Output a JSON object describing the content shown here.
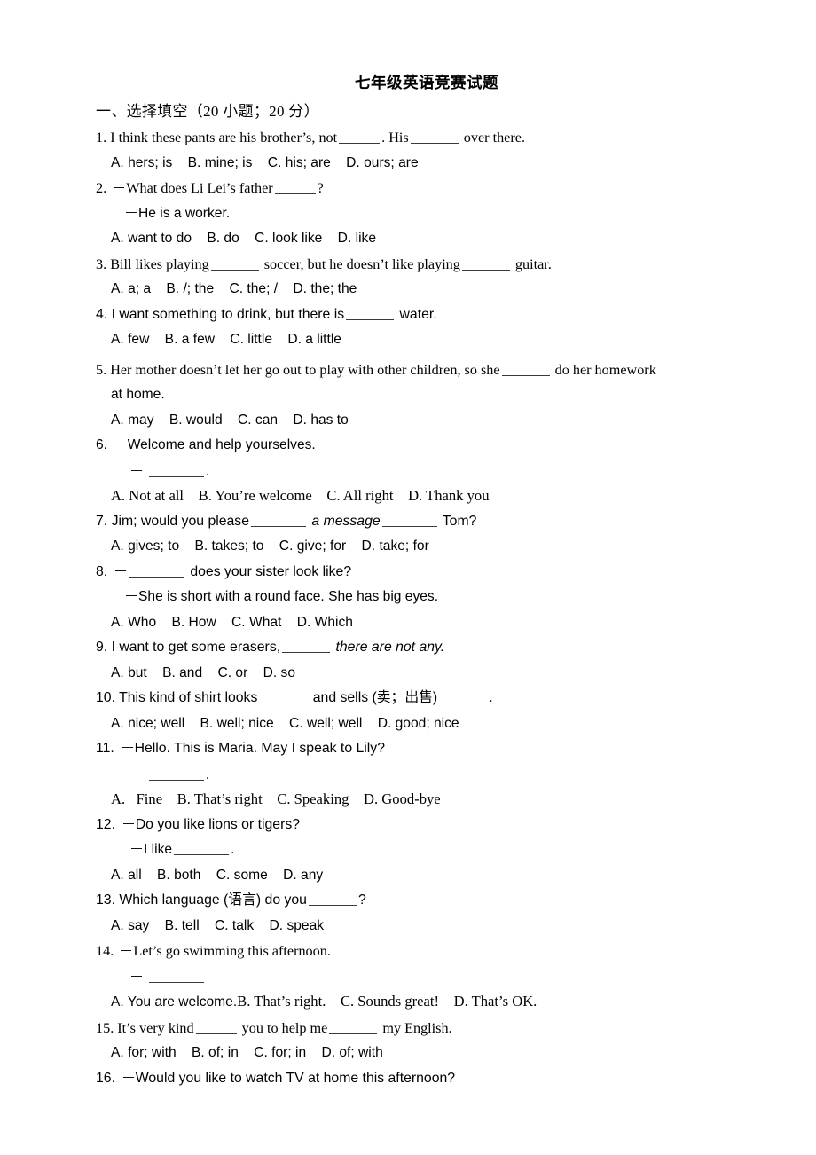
{
  "document": {
    "title": "七年级英语竞赛试题",
    "section_heading": "一、选择填空（20 小题；20 分）"
  },
  "questions": [
    {
      "number": "1.",
      "stem_pre": "I think these pants are his brother’s, not",
      "stem_mid": ". His",
      "stem_post": "over there.",
      "options": "A. hers; is    B. mine; is    C. his; are    D. ours; are"
    },
    {
      "number": "2.",
      "prompt": "What does Li Lei’s father",
      "prompt_post": "?",
      "reply": "He is a worker.",
      "options": "A. want to do    B. do    C. look like    D. like"
    },
    {
      "number": "3.",
      "stem_pre": "Bill likes playing",
      "stem_mid": "soccer, but he doesn’t like playing",
      "stem_post": "guitar.",
      "options": "A. a; a    B. /; the    C. the; /    D. the; the"
    },
    {
      "number": "4.",
      "stem_pre": "I want something to drink, but there is",
      "stem_post": "water.",
      "options": "A. few    B. a few    C. little    D. a little"
    },
    {
      "number": "5.",
      "stem_pre": "Her mother doesn’t let her go out to play with other children, so she",
      "stem_post": "do her homework",
      "stem_line2": "at home.",
      "options": "A. may    B. would    C. can    D. has to"
    },
    {
      "number": "6.",
      "prompt": "Welcome and help yourselves.",
      "reply_post": ".",
      "options": "A. Not at all    B. You’re welcome    C. All right    D. Thank you"
    },
    {
      "number": "7.",
      "stem_pre": "Jim; would you please",
      "stem_mid": "a message",
      "stem_post": "Tom?",
      "options": "A. gives; to    B. takes; to    C. give; for    D. take; for"
    },
    {
      "number": "8.",
      "stem_post": "does your sister look like?",
      "reply": "She is short with a round face. She has big eyes.",
      "options": "A. Who    B. How    C. What    D. Which"
    },
    {
      "number": "9.",
      "stem_pre": "I want to get some erasers,",
      "stem_post": "there are not any.",
      "options": "A. but    B. and    C. or    D. so"
    },
    {
      "number": "10.",
      "stem_pre": "This kind of shirt looks",
      "stem_mid": "and sells (卖；出售)",
      "stem_post": ".",
      "options": "A. nice; well    B. well; nice    C. well; well    D. good; nice"
    },
    {
      "number": "11.",
      "prompt": "Hello. This is Maria. May I speak to Lily?",
      "reply_post": ".",
      "options": "A.   Fine    B. That’s right    C. Speaking    D. Good-bye"
    },
    {
      "number": "12.",
      "prompt": "Do you like lions or tigers?",
      "reply_pre": "I like",
      "reply_post": ".",
      "options": "A. all    B. both    C. some    D. any"
    },
    {
      "number": "13.",
      "stem_pre": "Which language (语言) do you",
      "stem_post": "?",
      "options": "A. say    B. tell    C. talk    D. speak"
    },
    {
      "number": "14.",
      "prompt": "Let’s go swimming this afternoon.",
      "options_a": "A. You are welcome.",
      "options_rest": "B. That’s right.    C. Sounds great!    D. That’s OK."
    },
    {
      "number": "15.",
      "stem_pre": "It’s very kind",
      "stem_mid": "you to help me",
      "stem_post": "my English.",
      "options": "A. for; with    B. of; in    C. for; in    D. of; with"
    },
    {
      "number": "16.",
      "prompt": "Would you like to watch TV at home this afternoon?"
    }
  ]
}
